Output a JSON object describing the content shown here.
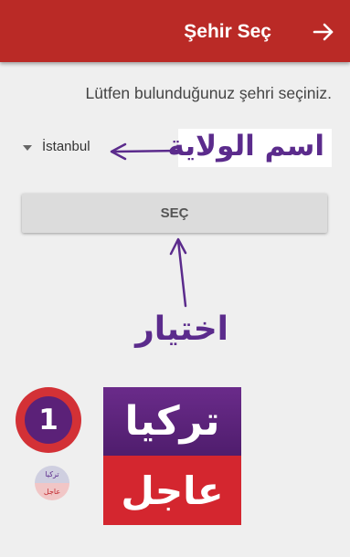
{
  "appbar": {
    "title": "Şehir Seç",
    "action_icon": "arrow-right-icon",
    "color": "#ba2a26"
  },
  "prompt": "Lütfen bulunduğunuz şehri seçiniz.",
  "city_dropdown": {
    "selected_value": "İstanbul"
  },
  "select_button": {
    "label": "SEÇ"
  },
  "annotations": {
    "state_name": "اسم الولاية",
    "choice": "اختيار",
    "color": "#5b2b8c"
  },
  "watermark": {
    "badge_number": "1",
    "mini_logo_top": "تركيا",
    "mini_logo_bottom": "عاجل",
    "logo_top": "تركيا",
    "logo_bottom": "عاجل"
  }
}
